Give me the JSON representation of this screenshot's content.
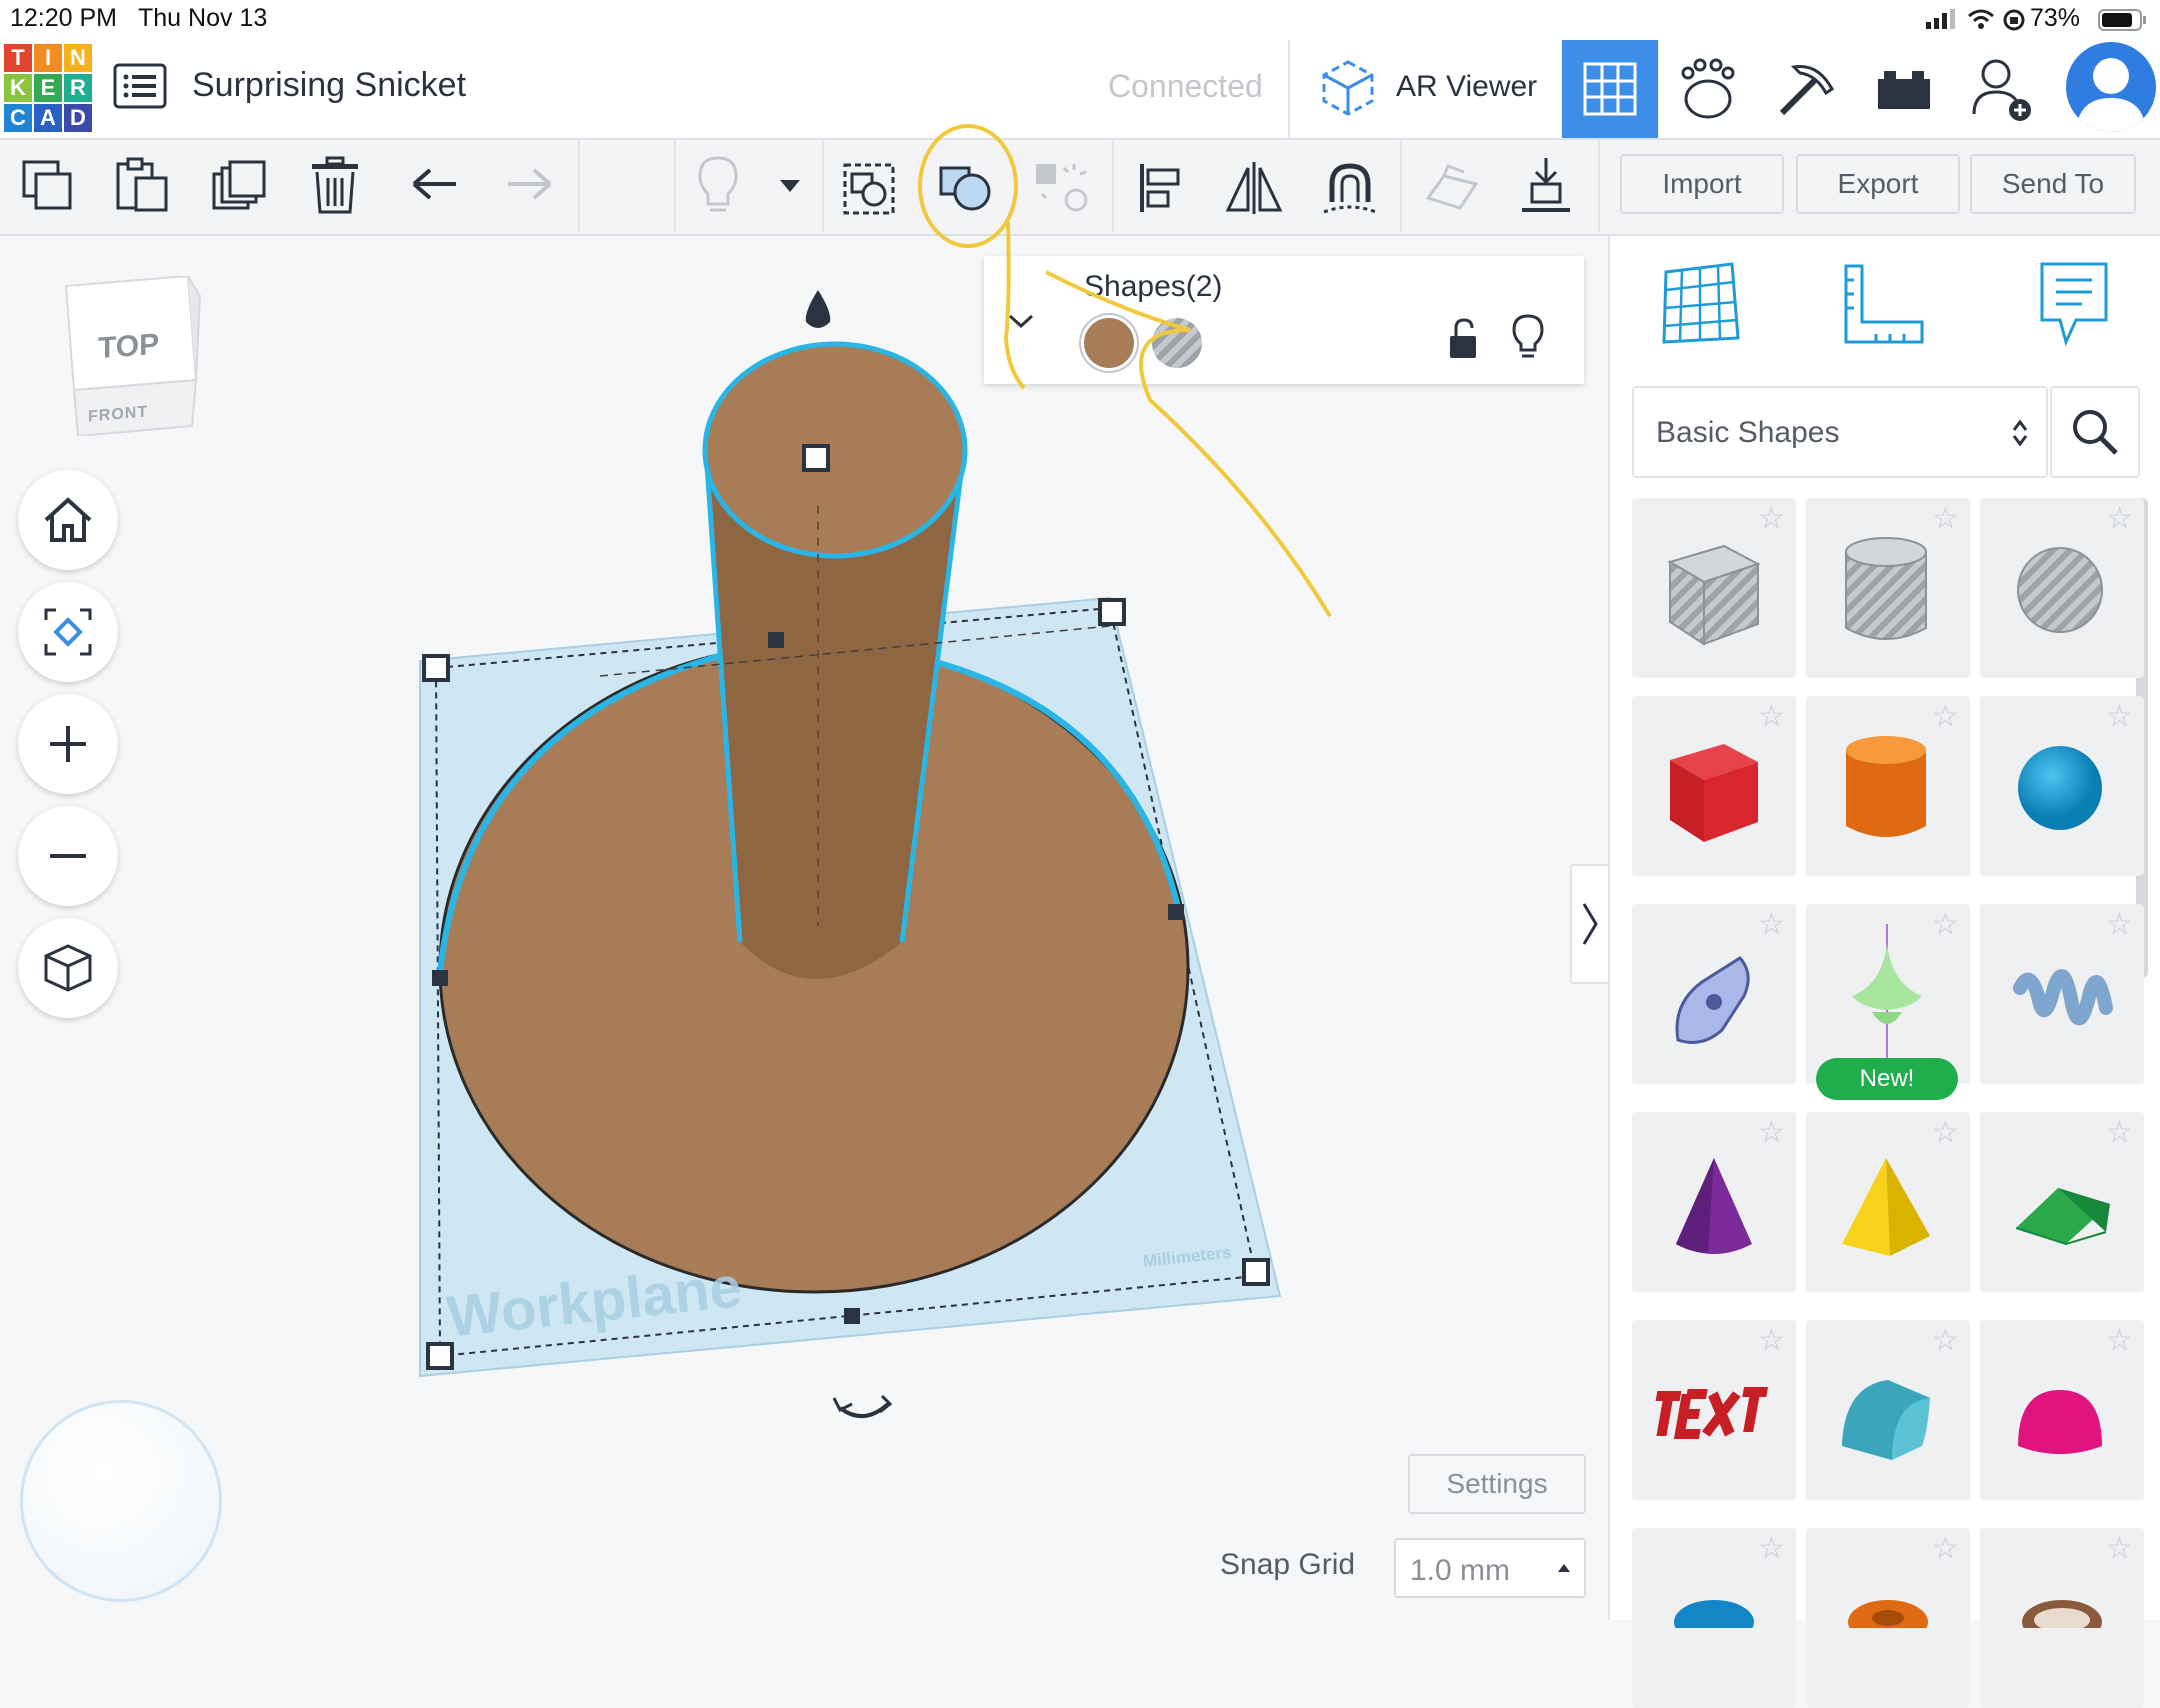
{
  "status": {
    "time": "12:20 PM",
    "date": "Thu Nov 13",
    "battery": "73%"
  },
  "logo_letters": [
    "T",
    "I",
    "N",
    "K",
    "E",
    "R",
    "C",
    "A",
    "D"
  ],
  "header": {
    "title": "Surprising Snicket",
    "connection": "Connected",
    "ar_viewer": "AR Viewer"
  },
  "toolbar": {
    "import": "Import",
    "export": "Export",
    "send_to": "Send To"
  },
  "view_cube": {
    "top": "TOP",
    "front": "FRONT"
  },
  "inspector": {
    "title": "Shapes(2)",
    "solid_color": "#a77c56"
  },
  "library": {
    "category": "Basic Shapes",
    "new_badge": "New!"
  },
  "workplane": {
    "label": "Workplane",
    "units": "Millimeters"
  },
  "footer": {
    "settings": "Settings",
    "snap_label": "Snap Grid",
    "snap_value": "1.0 mm"
  },
  "colors": {
    "accent": "#3d8ee8",
    "selection": "#29b6e6",
    "annotation": "#f0c93c",
    "shape_brown": "#a77c56",
    "new_badge": "#1fae4b"
  }
}
